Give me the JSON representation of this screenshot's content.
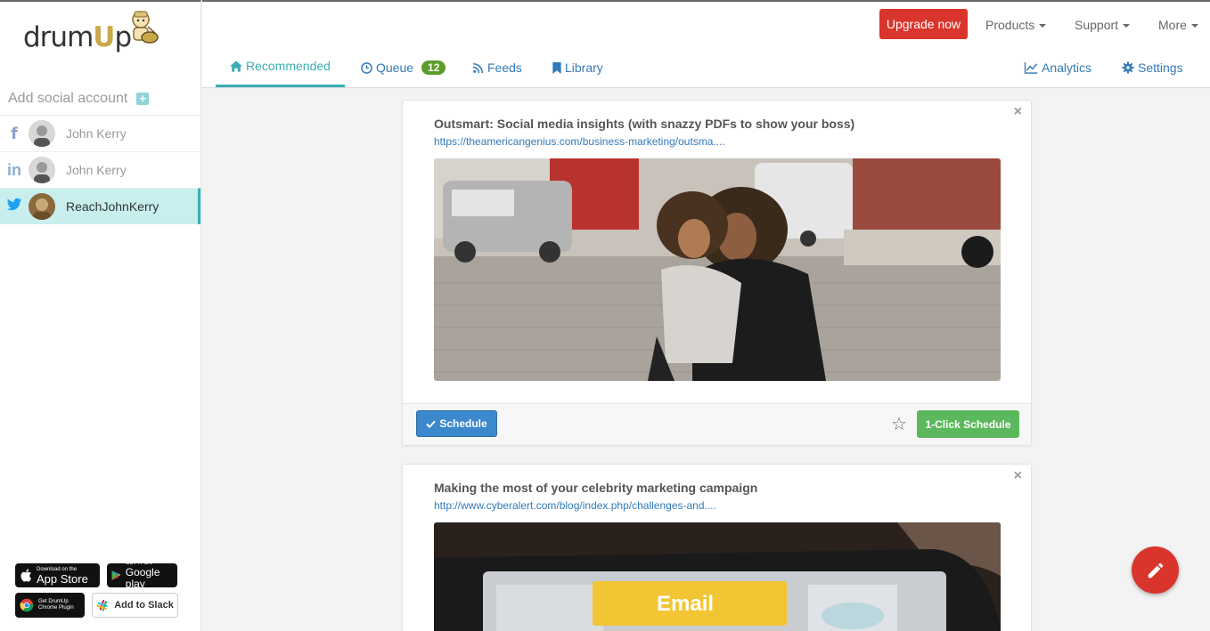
{
  "brand": {
    "logo_text_start": "drum",
    "logo_text_u": "U",
    "logo_text_end": "p"
  },
  "sidebar": {
    "add_account_label": "Add social account",
    "accounts": [
      {
        "network": "facebook",
        "name": "John Kerry",
        "color": "#3b5998"
      },
      {
        "network": "linkedin",
        "name": "John Kerry",
        "color": "#0e76a8"
      },
      {
        "network": "twitter",
        "name": "ReachJohnKerry",
        "color": "#1da1f2",
        "active": true
      }
    ],
    "stores": {
      "appstore_small": "Download on the",
      "appstore_big": "App Store",
      "googleplay_small": "GET IT ON",
      "googleplay_big": "Google play",
      "chrome_line1": "Get DrumUp",
      "chrome_line2": "Chrome Plugin",
      "slack": "Add to Slack"
    }
  },
  "header": {
    "upgrade": "Upgrade now",
    "menu": {
      "products": "Products",
      "support": "Support",
      "more": "More"
    },
    "tabs": {
      "recommended": "Recommended",
      "queue": "Queue",
      "queue_count": "12",
      "feeds": "Feeds",
      "library": "Library",
      "analytics": "Analytics",
      "settings": "Settings"
    }
  },
  "cards": [
    {
      "title": "Outsmart: Social media insights (with snazzy PDFs to show your boss)",
      "link": "https://theamericangenius.com/business-marketing/outsma....",
      "schedule": "Schedule",
      "one_click": "1-Click Schedule",
      "close": "×"
    },
    {
      "title": "Making the most of your celebrity marketing campaign",
      "link": "http://www.cyberalert.com/blog/index.php/challenges-and....",
      "image_text": "Email",
      "close": "×"
    }
  ],
  "colors": {
    "accent": "#3aaeb5",
    "danger": "#d9352c",
    "success": "#5cb85c",
    "primary": "#3b88cc"
  }
}
